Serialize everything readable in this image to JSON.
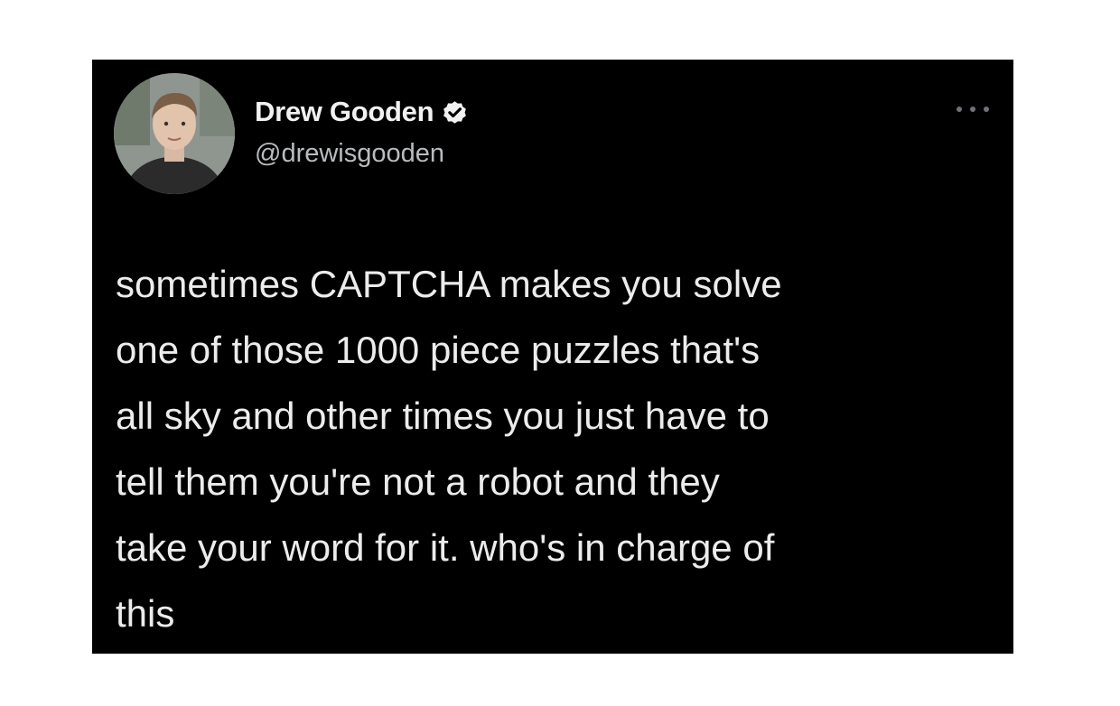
{
  "tweet": {
    "author": {
      "display_name": "Drew Gooden",
      "handle": "@drewisgooden",
      "verified": true,
      "avatar_icon": "profile-photo"
    },
    "more_icon": "more-horizontal-icon",
    "text_lines": [
      "sometimes CAPTCHA makes you solve",
      "one of those 1000 piece puzzles that's",
      "all sky and other times you just have to",
      "tell them you're not a robot and they",
      "take your word for it. who's in charge of",
      "this"
    ]
  },
  "colors": {
    "card_background": "#000000",
    "page_background": "#ffffff",
    "primary_text": "#ececec",
    "secondary_text": "#b9bcbf"
  }
}
